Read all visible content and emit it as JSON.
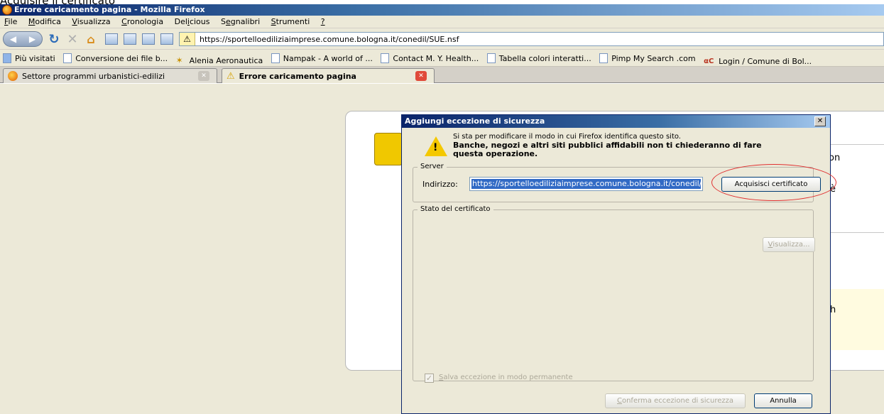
{
  "caption": "Acquisire il certificato",
  "window": {
    "title": "Errore caricamento pagina - Mozilla Firefox"
  },
  "menu": [
    {
      "acc": "F",
      "rest": "ile"
    },
    {
      "acc": "M",
      "rest": "odifica"
    },
    {
      "acc": "V",
      "rest": "isualizza"
    },
    {
      "acc": "C",
      "rest": "ronologia"
    },
    {
      "pre": "Del",
      "acc": "i",
      "rest": "cious"
    },
    {
      "pre": "S",
      "acc": "e",
      "rest": "gnalibri"
    },
    {
      "acc": "S",
      "rest": "trumenti"
    },
    {
      "acc": "?",
      "rest": ""
    }
  ],
  "url": "https://sportelloediliziaimprese.comune.bologna.it/conedil/SUE.nsf",
  "bookmarks": [
    "Più visitati",
    "Conversione dei file b...",
    "Alenia Aeronautica",
    "Nampak - A world of ...",
    "Contact M. Y. Health...",
    "Tabella colori interatti...",
    "Pimp My Search .com",
    "Login / Comune di Bol..."
  ],
  "tabs": [
    "Settore programmi urbanistici-edilizi",
    "Errore caricamento pagina"
  ],
  "error_page": {
    "frag_on": "on",
    "frag_e": "è",
    "frag_h": "h"
  },
  "dialog": {
    "title": "Aggiungi eccezione di sicurezza",
    "msg1": "Si sta per modificare il modo in cui Firefox identifica questo sito.",
    "msg2": "Banche, negozi e altri siti pubblici affidabili non ti chiederanno di fare questa operazione.",
    "server_legend": "Server",
    "address_label": "Indirizzo:",
    "address_value": "https://sportelloediliziaimprese.comune.bologna.it/conedil/SUE.nsf",
    "get_cert": "Acquisisci certificato",
    "status_legend": "Stato del certificato",
    "view": {
      "acc": "V",
      "rest": "isualizza..."
    },
    "save_permanent": {
      "acc": "S",
      "rest": "alva eccezione in modo permanente"
    },
    "confirm": {
      "acc": "C",
      "rest": "onferma eccezione di sicurezza"
    },
    "cancel": "Annulla"
  }
}
